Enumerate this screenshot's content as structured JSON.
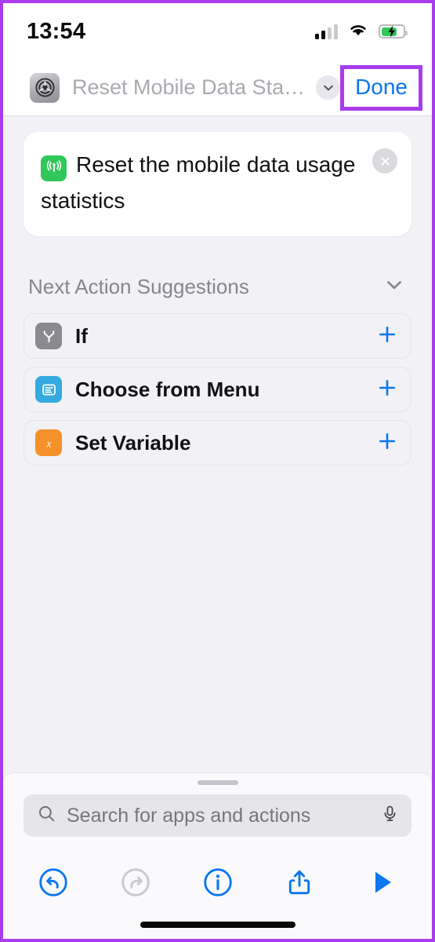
{
  "status_bar": {
    "time": "13:54",
    "signal_icon": "cellular-signal-icon",
    "signal_bars_filled": 2,
    "signal_bars_total": 4,
    "wifi_icon": "wifi-icon",
    "battery_icon": "battery-charging-icon",
    "battery_color": "#34c759"
  },
  "nav_bar": {
    "app_icon": "shortcut-settings-icon",
    "title": "Reset Mobile Data Statistics",
    "chevron_icon": "chevron-down-icon",
    "done_label": "Done",
    "done_color": "#0b76ef",
    "highlight_color": "#a93ceb"
  },
  "action_card": {
    "icon": "cellular-broadcast-icon",
    "icon_color": "#31c75a",
    "text": "Reset the mobile data usage statistics",
    "close_icon": "close-circle-icon"
  },
  "suggestions": {
    "header": "Next Action Suggestions",
    "collapse_icon": "chevron-down-icon",
    "items": [
      {
        "label": "If",
        "icon": "branch-if-icon",
        "icon_color": "#8a8a90",
        "add_icon": "plus-icon"
      },
      {
        "label": "Choose from Menu",
        "icon": "menu-list-icon",
        "icon_color": "#34aade",
        "add_icon": "plus-icon"
      },
      {
        "label": "Set Variable",
        "icon": "variable-x-icon",
        "icon_color": "#f5912a",
        "add_icon": "plus-icon"
      }
    ]
  },
  "search": {
    "placeholder": "Search for apps and actions",
    "value": "",
    "search_icon": "search-icon",
    "mic_icon": "microphone-icon"
  },
  "toolbar": {
    "buttons": [
      {
        "name": "undo-button",
        "icon": "undo-icon",
        "enabled": true
      },
      {
        "name": "redo-button",
        "icon": "redo-icon",
        "enabled": false
      },
      {
        "name": "info-button",
        "icon": "info-circle-icon",
        "enabled": true
      },
      {
        "name": "share-button",
        "icon": "share-icon",
        "enabled": true
      },
      {
        "name": "run-button",
        "icon": "play-icon",
        "enabled": true
      }
    ],
    "accent_color": "#0b76ef",
    "disabled_color": "#c3c3c9"
  }
}
